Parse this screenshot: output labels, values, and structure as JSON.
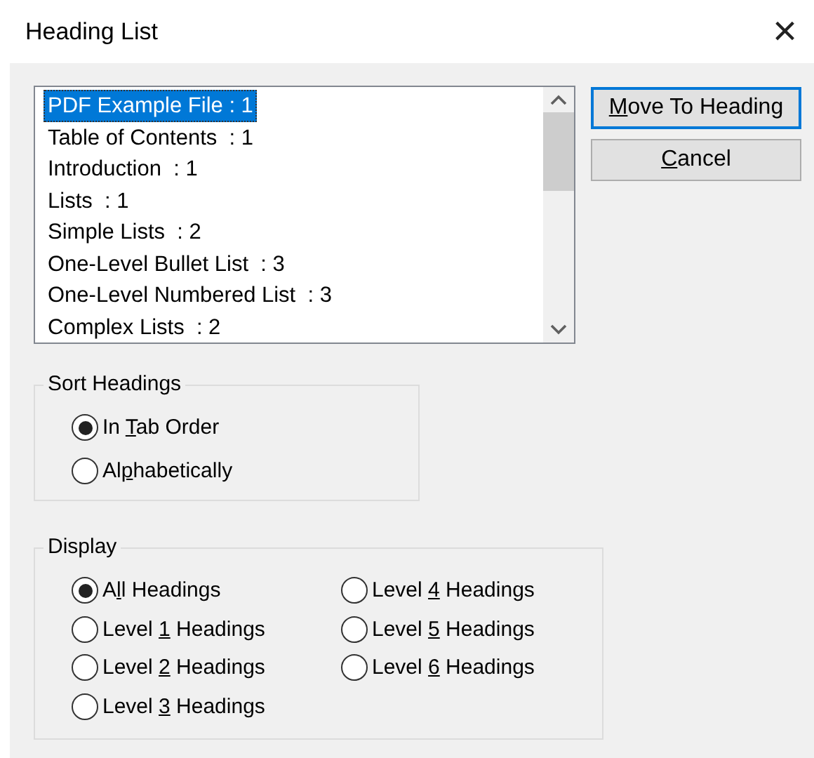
{
  "window": {
    "title": "Heading List",
    "close": "×"
  },
  "headings": [
    {
      "label": "PDF Example File : 1",
      "selected": true
    },
    {
      "label": "Table of Contents  : 1",
      "selected": false
    },
    {
      "label": "Introduction  : 1",
      "selected": false
    },
    {
      "label": "Lists  : 1",
      "selected": false
    },
    {
      "label": "Simple Lists  : 2",
      "selected": false
    },
    {
      "label": "One-Level Bullet List  : 3",
      "selected": false
    },
    {
      "label": "One-Level Numbered List  : 3",
      "selected": false
    },
    {
      "label": "Complex Lists  : 2",
      "selected": false
    }
  ],
  "buttons": [
    {
      "label": {
        "key": "M",
        "after": "ove To Heading"
      },
      "default": true
    },
    {
      "label": {
        "key": "C",
        "after": "ancel"
      },
      "default": false
    }
  ],
  "sort_headings": {
    "title": "Sort Headings",
    "options": [
      {
        "label": [
          "In ",
          "T",
          "ab Order"
        ],
        "selected": true
      },
      {
        "label": [
          "Al",
          "p",
          "habetically"
        ],
        "selected": false
      }
    ]
  },
  "display": {
    "title": "Display",
    "options": [
      {
        "label": [
          "A",
          "l",
          "l Headings"
        ],
        "selected": true
      },
      {
        "label": [
          "Level ",
          "1",
          " Headings"
        ],
        "selected": false
      },
      {
        "label": [
          "Level ",
          "2",
          " Headings"
        ],
        "selected": false
      },
      {
        "label": [
          "Level ",
          "3",
          " Headings"
        ],
        "selected": false
      },
      {
        "label": [
          "Level ",
          "4",
          " Headings"
        ],
        "selected": false
      },
      {
        "label": [
          "Level ",
          "5",
          " Headings"
        ],
        "selected": false
      },
      {
        "label": [
          "Level ",
          "6",
          " Headings"
        ],
        "selected": false
      }
    ]
  }
}
